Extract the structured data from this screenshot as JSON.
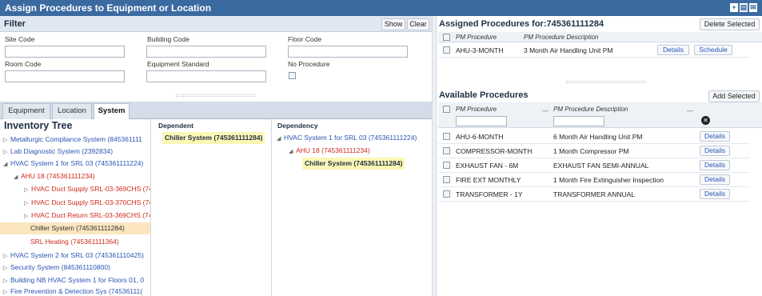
{
  "window": {
    "title": "Assign Procedures to Equipment or Location"
  },
  "filter": {
    "title": "Filter",
    "show_label": "Show",
    "clear_label": "Clear",
    "fields": [
      {
        "label": "Site Code",
        "value": ""
      },
      {
        "label": "Building Code",
        "value": ""
      },
      {
        "label": "Floor Code",
        "value": ""
      },
      {
        "label": "Room Code",
        "value": ""
      },
      {
        "label": "Equipment Standard",
        "value": ""
      }
    ],
    "no_procedure_label": "No Procedure"
  },
  "tabs": [
    {
      "label": "Equipment"
    },
    {
      "label": "Location"
    },
    {
      "label": "System",
      "active": true
    }
  ],
  "tree": {
    "title": "Inventory Tree",
    "items": [
      {
        "label": "Metallurgic Compliance System (845361111",
        "arrow": "▷"
      },
      {
        "label": "Lab Diagnostic System (2392834)",
        "arrow": "▷"
      },
      {
        "label": "HVAC System 1 for SRL 03 (745361111224)",
        "arrow": "◢"
      },
      {
        "label": "AHU 18 (745361111234)",
        "arrow": "◢"
      },
      {
        "label": "HVAC Duct Supply SRL-03-369CHS (74",
        "arrow": "▷"
      },
      {
        "label": "HVAC Duct Supply SRL-03-370CHS (74",
        "arrow": "▷"
      },
      {
        "label": "HVAC Duct Return SRL-03-369CHS (74",
        "arrow": "▷"
      },
      {
        "label": "Chiller System (745361111284)",
        "arrow": ""
      },
      {
        "label": "SRL Heating (745361111364)",
        "arrow": ""
      },
      {
        "label": "HVAC System 2 for SRL 03 (745361110425)",
        "arrow": "▷"
      },
      {
        "label": "Security System (845361110800)",
        "arrow": "▷"
      },
      {
        "label": "Building NB HVAC System 1 for Floors 01, 0",
        "arrow": "▷"
      },
      {
        "label": "Fire Prevention & Detection Sys (74536111(",
        "arrow": "▷"
      }
    ]
  },
  "dependent": {
    "title": "Dependent",
    "items": [
      {
        "label": "Chiller System (745361111284)"
      }
    ]
  },
  "dependency": {
    "title": "Dependency",
    "items": [
      {
        "label": "HVAC System 1 for SRL 03 (745361111224)",
        "arrow": "◢"
      },
      {
        "label": "AHU 18 (745361111234)",
        "arrow": "◢"
      },
      {
        "label": "Chiller System (745361111284)",
        "arrow": ""
      }
    ]
  },
  "assigned": {
    "title": "Assigned Procedures for:745361111284",
    "delete_label": "Delete Selected",
    "columns": [
      "PM Procedure",
      "PM Procedure Description"
    ],
    "rows": [
      {
        "procedure": "AHU-3-MONTH",
        "description": "3 Month Air Handling Unit PM",
        "details": "Details",
        "schedule": "Schedule"
      }
    ]
  },
  "available": {
    "title": "Available Procedures",
    "add_label": "Add Selected",
    "columns": [
      "PM Procedure",
      "PM Procedure Description"
    ],
    "rows": [
      {
        "procedure": "AHU-6-MONTH",
        "description": "6 Month Air Handling Unit PM",
        "details": "Details"
      },
      {
        "procedure": "COMPRESSOR-MONTH",
        "description": "1 Month Compressor PM",
        "details": "Details"
      },
      {
        "procedure": "EXHAUST FAN - 6M",
        "description": "EXHAUST FAN SEMI-ANNUAL",
        "details": "Details"
      },
      {
        "procedure": "FIRE EXT MONTHLY",
        "description": "1 Month Fire Extinguisher Inspection",
        "details": "Details"
      },
      {
        "procedure": "TRANSFORMER - 1Y",
        "description": "TRANSFORMER ANNUAL",
        "details": "Details"
      }
    ]
  },
  "colors": {
    "titlebar": "#3b6aa0",
    "link_blue": "#2a55b5",
    "node_red": "#d02a1c",
    "selected": "#fbe6bf",
    "highlight": "#fbf7b5"
  }
}
